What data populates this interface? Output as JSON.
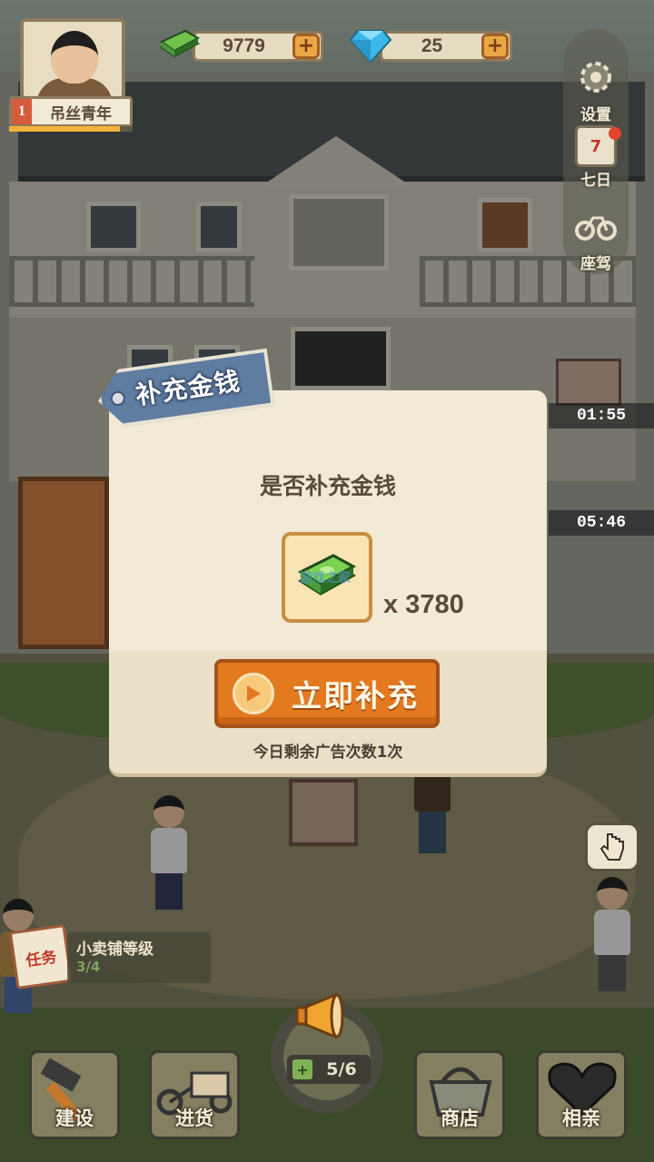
{
  "hud": {
    "player_level": "1",
    "player_title": "吊丝青年",
    "xp_fraction": 0.9,
    "money": "9779",
    "gems": "25",
    "plus_symbol": "+"
  },
  "side_menu": {
    "settings_label": "设置",
    "seven_day_day": "7",
    "seven_day_label": "七日",
    "vehicle_label": "座驾"
  },
  "timers": [
    "01:55",
    "05:46"
  ],
  "task": {
    "card_label": "任务",
    "title": "小卖铺等级",
    "progress": "3/4"
  },
  "bottom_nav": {
    "build": "建设",
    "restock": "进货",
    "ticket_count": "5/6",
    "shop": "商店",
    "dating": "相亲"
  },
  "dialog": {
    "ribbon_title": "补充金钱",
    "question": "是否补充金钱",
    "reward_amount": "x 3780",
    "watermark": "游戏之家",
    "confirm_label": "立即补充",
    "ads_remaining": "今日剩余广告次数1次"
  },
  "colors": {
    "cta_orange": "#e47a1f",
    "ribbon_blue": "#5f7ca1",
    "dialog_bg": "#f2ead6"
  }
}
